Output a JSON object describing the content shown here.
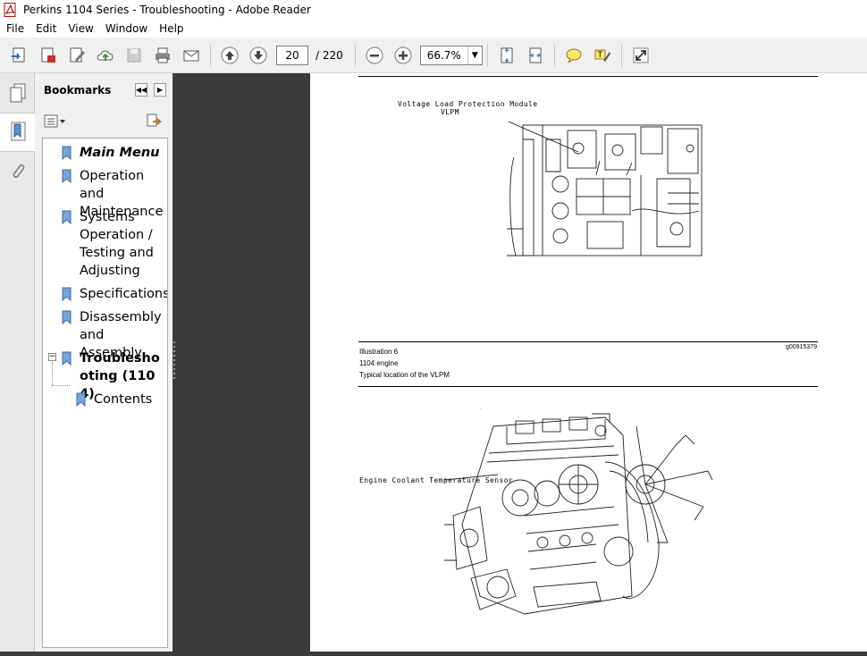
{
  "window": {
    "title": "Perkins 1104 Series - Troubleshooting - Adobe Reader"
  },
  "menu": [
    "File",
    "Edit",
    "View",
    "Window",
    "Help"
  ],
  "toolbar": {
    "page_current": "20",
    "page_total": "/ 220",
    "zoom": "66.7%"
  },
  "bookmarks": {
    "header": "Bookmarks",
    "items": [
      {
        "label": "Main Menu"
      },
      {
        "label": "Operation and Maintenance"
      },
      {
        "label": "Systems Operation / Testing and Adjusting"
      },
      {
        "label": "Specifications"
      },
      {
        "label": "Disassembly and Assembly"
      },
      {
        "label": "Troubleshooting (1104)"
      },
      {
        "label": "Contents"
      }
    ],
    "expand_symbol": "−"
  },
  "document": {
    "label_vlpm_line1": "Voltage Load Protection Module",
    "label_vlpm_line2": "VLPM",
    "illustration_title": "Illustration 6",
    "illustration_id": "g00915379",
    "illustration_line2": "1104 engine",
    "illustration_line3": "Typical location of the VLPM",
    "label_ect_sensor": "Engine Coolant Temperature Sensor"
  }
}
